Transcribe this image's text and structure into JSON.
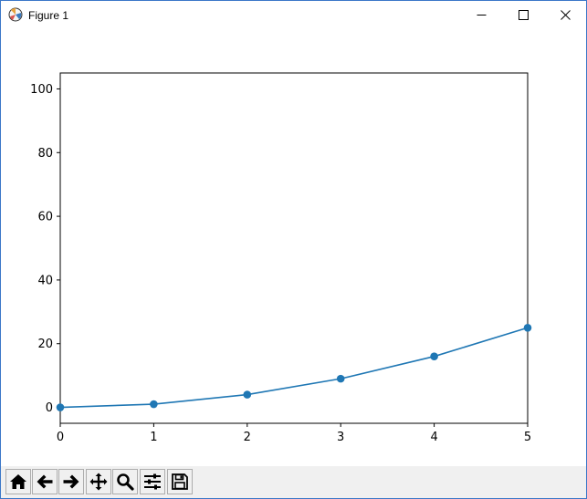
{
  "window": {
    "title": "Figure 1",
    "controls": {
      "minimize_icon": "minimize-icon",
      "maximize_icon": "maximize-icon",
      "close_icon": "close-icon"
    }
  },
  "toolbar": {
    "buttons": [
      {
        "icon": "home-icon"
      },
      {
        "icon": "back-arrow-icon"
      },
      {
        "icon": "forward-arrow-icon"
      },
      {
        "icon": "pan-icon"
      },
      {
        "icon": "zoom-icon"
      },
      {
        "icon": "configure-subplots-icon"
      },
      {
        "icon": "save-icon"
      }
    ]
  },
  "colors": {
    "series": "#1f77b4",
    "window_border": "#3c78c8",
    "toolbar_bg": "#f0f0f0"
  },
  "chart_data": {
    "type": "line",
    "markers": "circle",
    "x": [
      0,
      1,
      2,
      3,
      4,
      5
    ],
    "series": [
      {
        "values": [
          0,
          1,
          4,
          9,
          16,
          25
        ]
      }
    ],
    "xlim": [
      0,
      5
    ],
    "ylim": [
      -5,
      105
    ],
    "xticks": [
      "0",
      "1",
      "2",
      "3",
      "4",
      "5"
    ],
    "yticks": [
      "0",
      "20",
      "40",
      "60",
      "80",
      "100"
    ],
    "grid": false,
    "title": "",
    "xlabel": "",
    "ylabel": ""
  }
}
